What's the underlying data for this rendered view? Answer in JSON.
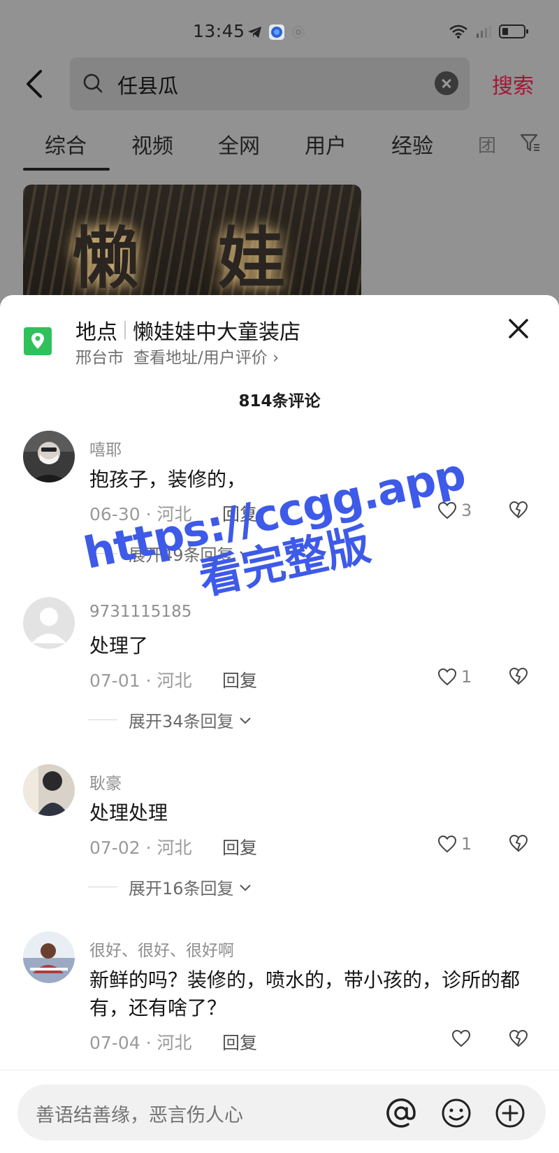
{
  "status_bar": {
    "time": "13:45"
  },
  "search": {
    "back_label": "",
    "query": "任县瓜",
    "action": "搜索"
  },
  "tabs": [
    {
      "label": "综合"
    },
    {
      "label": "视频"
    },
    {
      "label": "全网"
    },
    {
      "label": "用户"
    },
    {
      "label": "经验"
    },
    {
      "label": "团"
    }
  ],
  "thumbnail": {
    "sign_text": "懒 娃"
  },
  "location": {
    "prefix": "地点",
    "name": "懒娃娃中大童装店",
    "city": "邢台市",
    "link": "查看地址/用户评价 ›"
  },
  "comments_header": {
    "count_text": "814条评论"
  },
  "comments": [
    {
      "user": "嘻耶",
      "text": "抱孩子，装修的，",
      "date": "06-30 · 河北",
      "reply": "回复",
      "likes": "3",
      "expand": "展开49条回复"
    },
    {
      "user": "9731115185",
      "text": "处理了",
      "date": "07-01 · 河北",
      "reply": "回复",
      "likes": "1",
      "expand": "展开34条回复"
    },
    {
      "user": "耿豪",
      "text": "处理处理",
      "date": "07-02 · 河北",
      "reply": "回复",
      "likes": "1",
      "expand": "展开16条回复"
    },
    {
      "user": "很好、很好、很好啊",
      "text": "新鲜的吗？装修的，喷水的，带小孩的，诊所的都有，还有啥了？",
      "date": "07-04 · 河北",
      "reply": "回复",
      "likes": ""
    }
  ],
  "comment_input": {
    "placeholder": "善语结善缘，恶言伤人心"
  },
  "watermark": {
    "line1": "https://ccgg.app",
    "line2": "看完整版"
  },
  "colors": {
    "accent": "#a31734",
    "location_green": "#2fc15a",
    "watermark_blue": "#3e5ae8"
  }
}
